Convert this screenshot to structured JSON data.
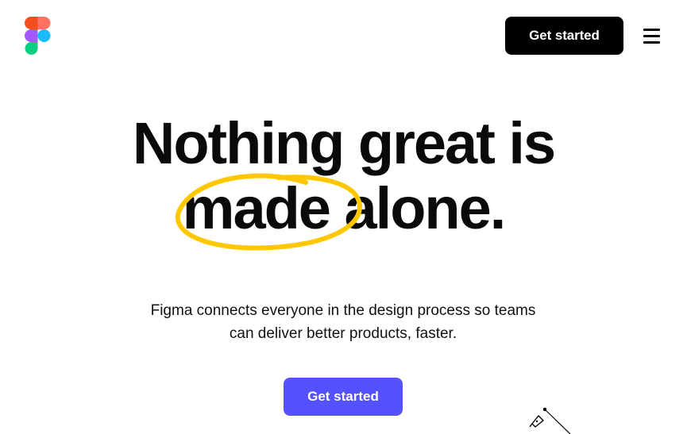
{
  "header": {
    "logo_icon": "figma-logo-icon",
    "cta_label": "Get started",
    "menu_icon": "hamburger-menu-icon"
  },
  "hero": {
    "title_line1": "Nothing great is",
    "title_highlight": "made",
    "title_line2_rest": "alone.",
    "circle_color": "#ffc700",
    "subtitle": "Figma connects everyone in the design process so teams can deliver better products, faster.",
    "cta_label": "Get started",
    "cta_color": "#5551ff"
  },
  "decoration": {
    "pen_icon": "pen-tool-icon"
  },
  "colors": {
    "logo_red": "#f24e1e",
    "logo_orange": "#ff7262",
    "logo_purple": "#a259ff",
    "logo_blue": "#1abcfe",
    "logo_green": "#0acf83"
  }
}
